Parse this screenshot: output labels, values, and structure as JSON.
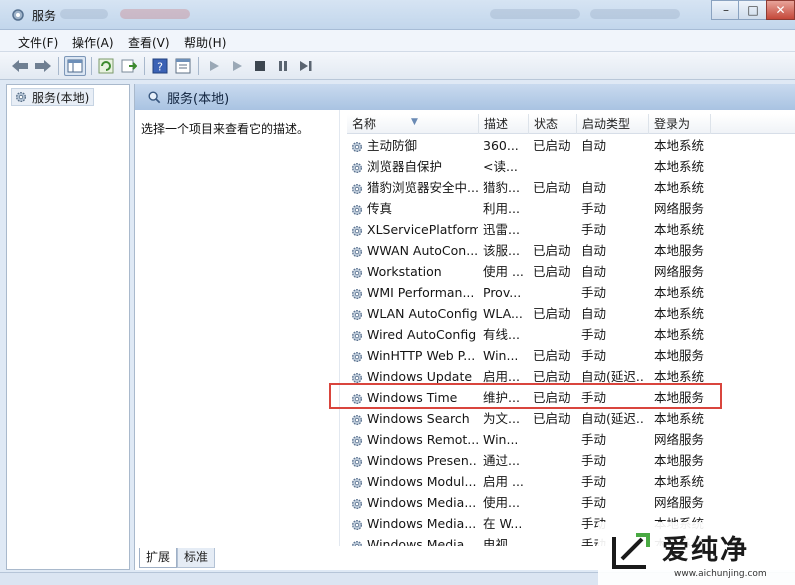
{
  "window": {
    "title": "服务",
    "controls": {
      "minimize": "–",
      "maximize": "□",
      "close": "✕"
    }
  },
  "menu": [
    "文件(F)",
    "操作(A)",
    "查看(V)",
    "帮助(H)"
  ],
  "toolbar": {
    "icons": [
      "back-arrow-icon",
      "forward-arrow-icon",
      "show-hide-tree-icon",
      "refresh-icon",
      "export-list-icon",
      "help-icon",
      "properties-icon",
      "start-service-icon",
      "start-service-alt-icon",
      "stop-service-icon",
      "pause-service-icon",
      "restart-service-icon"
    ]
  },
  "tree": {
    "root_label": "服务(本地)"
  },
  "main": {
    "header_title": "服务(本地)",
    "description_prompt": "选择一个项目来查看它的描述。",
    "columns": [
      "名称",
      "描述",
      "状态",
      "启动类型",
      "登录为"
    ],
    "rows": [
      {
        "name": "主动防御",
        "desc": "360...",
        "status": "已启动",
        "start": "自动",
        "logon": "本地系统"
      },
      {
        "name": "浏览器自保护",
        "desc": "<读...",
        "status": "",
        "start": "",
        "logon": "本地系统"
      },
      {
        "name": "猎豹浏览器安全中...",
        "desc": "猎豹...",
        "status": "已启动",
        "start": "自动",
        "logon": "本地系统"
      },
      {
        "name": "传真",
        "desc": "利用...",
        "status": "",
        "start": "手动",
        "logon": "网络服务"
      },
      {
        "name": "XLServicePlatform",
        "desc": "迅雷...",
        "status": "",
        "start": "手动",
        "logon": "本地系统"
      },
      {
        "name": "WWAN AutoCon...",
        "desc": "该服...",
        "status": "已启动",
        "start": "自动",
        "logon": "本地服务"
      },
      {
        "name": "Workstation",
        "desc": "使用 ...",
        "status": "已启动",
        "start": "自动",
        "logon": "网络服务"
      },
      {
        "name": "WMI Performan...",
        "desc": "Prov...",
        "status": "",
        "start": "手动",
        "logon": "本地系统"
      },
      {
        "name": "WLAN AutoConfig",
        "desc": "WLA...",
        "status": "已启动",
        "start": "自动",
        "logon": "本地系统"
      },
      {
        "name": "Wired AutoConfig",
        "desc": "有线...",
        "status": "",
        "start": "手动",
        "logon": "本地系统"
      },
      {
        "name": "WinHTTP Web P...",
        "desc": "Win...",
        "status": "已启动",
        "start": "手动",
        "logon": "本地服务"
      },
      {
        "name": "Windows Update",
        "desc": "启用...",
        "status": "已启动",
        "start": "自动(延迟...",
        "logon": "本地系统"
      },
      {
        "name": "Windows Time",
        "desc": "维护...",
        "status": "已启动",
        "start": "手动",
        "logon": "本地服务"
      },
      {
        "name": "Windows Search",
        "desc": "为文...",
        "status": "已启动",
        "start": "自动(延迟...",
        "logon": "本地系统"
      },
      {
        "name": "Windows Remot...",
        "desc": "Win...",
        "status": "",
        "start": "手动",
        "logon": "网络服务"
      },
      {
        "name": "Windows Presen...",
        "desc": "通过...",
        "status": "",
        "start": "手动",
        "logon": "本地服务"
      },
      {
        "name": "Windows Modul...",
        "desc": "启用 ...",
        "status": "",
        "start": "手动",
        "logon": "本地系统"
      },
      {
        "name": "Windows Media...",
        "desc": "使用...",
        "status": "",
        "start": "手动",
        "logon": "网络服务"
      },
      {
        "name": "Windows Media...",
        "desc": "在 W...",
        "status": "",
        "start": "手动",
        "logon": "本地系统"
      },
      {
        "name": "Windows Media...",
        "desc": "电视...",
        "status": "",
        "start": "手动",
        "logon": "本地系统"
      }
    ]
  },
  "tabs": [
    "扩展",
    "标准"
  ],
  "watermark": {
    "brand": "爱纯净",
    "url": "www.aichunjing.com"
  },
  "colors": {
    "highlight_border": "#d9453d",
    "header_blue": "#a9c3e2"
  }
}
